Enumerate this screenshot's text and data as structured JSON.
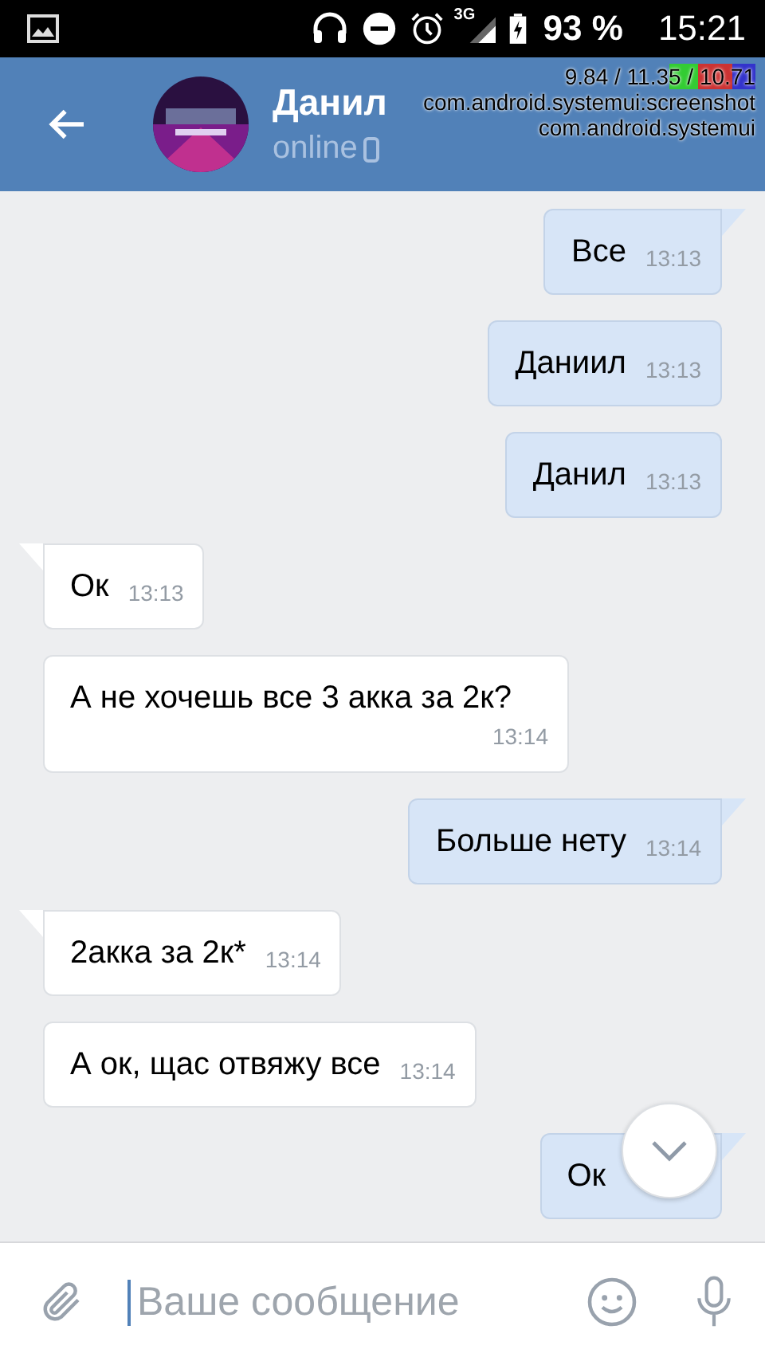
{
  "status_bar": {
    "battery": "93 %",
    "time": "15:21",
    "network": "3G"
  },
  "header": {
    "name": "Данил",
    "presence": "online"
  },
  "debug_overlay": [
    "9.84 / 11.35 / 10.71",
    "com.android.systemui:screenshot",
    "com.android.systemui"
  ],
  "messages": [
    {
      "text": "Все",
      "time": "13:13",
      "outgoing": true,
      "tail": true
    },
    {
      "text": "Даниил",
      "time": "13:13",
      "outgoing": true,
      "tail": false
    },
    {
      "text": "Данил",
      "time": "13:13",
      "outgoing": true,
      "tail": false
    },
    {
      "text": "Ок",
      "time": "13:13",
      "outgoing": false,
      "tail": true
    },
    {
      "text": "А не хочешь все 3 акка за 2к?",
      "time": "13:14",
      "outgoing": false,
      "tail": false
    },
    {
      "text": "Больше нету",
      "time": "13:14",
      "outgoing": true,
      "tail": true
    },
    {
      "text": "2акка за 2к*",
      "time": "13:14",
      "outgoing": false,
      "tail": true
    },
    {
      "text": "А ок, щас отвяжу все",
      "time": "13:14",
      "outgoing": false,
      "tail": false
    },
    {
      "text": "Ок",
      "outgoing": true,
      "tail": true
    }
  ],
  "composer": {
    "placeholder": "Ваше сообщение"
  }
}
